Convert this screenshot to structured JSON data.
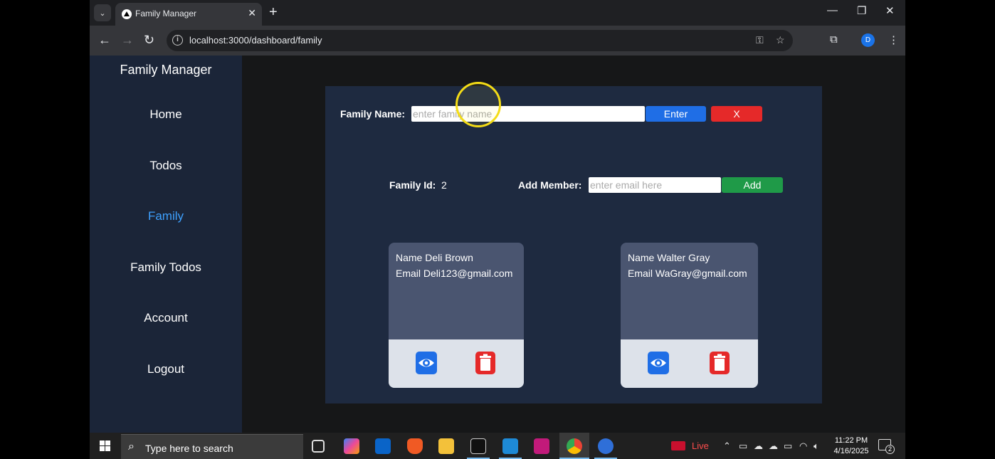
{
  "browser": {
    "tab_title": "Family Manager",
    "url": "localhost:3000/dashboard/family",
    "profile_initial": "D"
  },
  "sidebar": {
    "title": "Family Manager",
    "items": [
      {
        "label": "Home",
        "active": false
      },
      {
        "label": "Todos",
        "active": false
      },
      {
        "label": "Family",
        "active": true
      },
      {
        "label": "Family Todos",
        "active": false
      },
      {
        "label": "Account",
        "active": false
      },
      {
        "label": "Logout",
        "active": false
      }
    ]
  },
  "family_form": {
    "name_label": "Family Name:",
    "name_placeholder": "enter family name",
    "enter_label": "Enter",
    "cancel_label": "X"
  },
  "family_info": {
    "id_label": "Family Id:",
    "id_value": "2",
    "add_member_label": "Add Member:",
    "email_placeholder": "enter email here",
    "add_label": "Add"
  },
  "members": [
    {
      "name_line": "Name Deli Brown",
      "email_line": "Email Deli123@gmail.com"
    },
    {
      "name_line": "Name Walter Gray",
      "email_line": "Email WaGray@gmail.com"
    }
  ],
  "taskbar": {
    "search_placeholder": "Type here to search",
    "live_label": "Live",
    "time": "11:22 PM",
    "date": "4/16/2025",
    "notification_count": "2"
  },
  "colors": {
    "sidebar_bg": "#1b2538",
    "panel_bg": "#1e2a40",
    "active_nav": "#3ea1ff",
    "primary_blue": "#1f6ee6",
    "danger_red": "#e52929",
    "success_green": "#1f9a48"
  }
}
